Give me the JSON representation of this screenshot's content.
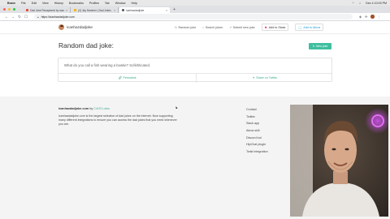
{
  "menubar": {
    "app": "Brave",
    "items": [
      "File",
      "Edit",
      "View",
      "History",
      "Bookmarks",
      "Profiles",
      "Tab",
      "Window",
      "Help"
    ],
    "clock": "Dec 4  10:03 PM"
  },
  "tabs": [
    {
      "title": "Dad Joke Recaptured by icanhazdadjoke.c...",
      "fav": "red"
    },
    {
      "title": "(2) Jay Hammer | Dad Jokes",
      "fav": "yel"
    },
    {
      "title": "icanhazdadjoke",
      "fav": "dark",
      "active": true
    }
  ],
  "address": {
    "url": "https://icanhazdadjoke.com"
  },
  "site": {
    "brand": "icanhazdadjoke",
    "nav": {
      "random": "Random joke",
      "search": "Search jokes",
      "submit": "Submit new joke",
      "slack": "Add to Slack",
      "alexa": "Add to Alexa"
    }
  },
  "main": {
    "title": "Random dad joke:",
    "new_joke": "New joke",
    "joke": "What do you call a fish wearing a bowtie? Sofishticated.",
    "permalink": "Permalink",
    "share": "Share on Twitter"
  },
  "footer": {
    "brand": "icanhazdadjoke.com",
    "by": "by",
    "company": "C4O3 Labs.",
    "description": "icanhazdadjoke.com is the largest selection of dad jokes on the internet. Now supporting many different integrations to ensure you can access the dad jokes that you need whenever you are.",
    "links": [
      "Contact",
      "Twitter",
      "Slack app",
      "Alexa skill",
      "Discord bot",
      "HipChat plugin",
      "Twist integration"
    ]
  },
  "colors": {
    "accent": "#3fbf9f",
    "link": "#3aaa8c",
    "footer_bg": "#f4f4f4"
  }
}
